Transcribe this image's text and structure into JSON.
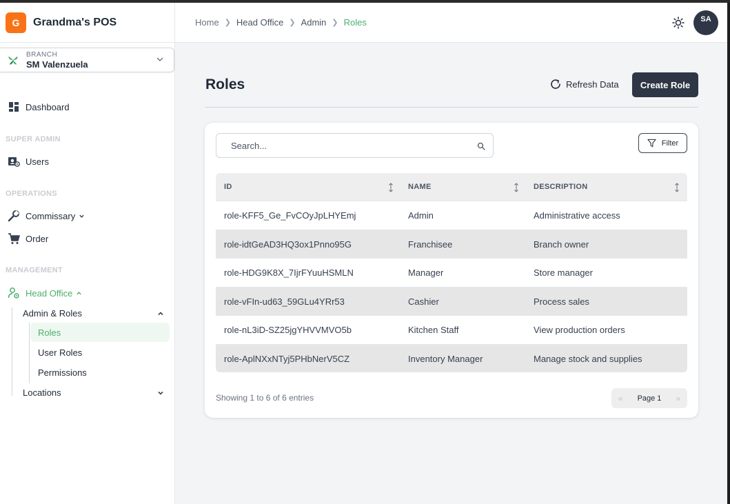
{
  "brand": {
    "logo_letter": "G",
    "name": "Grandma's POS",
    "accent": "#f97316"
  },
  "branch": {
    "label": "BRANCH",
    "value": "SM Valenzuela"
  },
  "nav": {
    "dashboard": "Dashboard",
    "section_super_admin": "SUPER ADMIN",
    "users": "Users",
    "section_operations": "OPERATIONS",
    "commissary": "Commissary",
    "order": "Order",
    "section_management": "MANAGEMENT",
    "head_office": "Head Office",
    "admin_roles": "Admin & Roles",
    "roles": "Roles",
    "user_roles": "User Roles",
    "permissions": "Permissions",
    "locations": "Locations"
  },
  "breadcrumb": [
    "Home",
    "Head Office",
    "Admin",
    "Roles"
  ],
  "header": {
    "avatar_initials": "SA"
  },
  "page": {
    "title": "Roles",
    "refresh_label": "Refresh Data",
    "create_label": "Create Role"
  },
  "search": {
    "placeholder": "Search...",
    "value": ""
  },
  "filter_label": "Filter",
  "table": {
    "columns": [
      "ID",
      "NAME",
      "DESCRIPTION"
    ],
    "rows": [
      {
        "id": "role-KFF5_Ge_FvCOyJpLHYEmj",
        "name": "Admin",
        "description": "Administrative access"
      },
      {
        "id": "role-idtGeAD3HQ3ox1Pnno95G",
        "name": "Franchisee",
        "description": "Branch owner"
      },
      {
        "id": "role-HDG9K8X_7IjrFYuuHSMLN",
        "name": "Manager",
        "description": "Store manager"
      },
      {
        "id": "role-vFIn-ud63_59GLu4YRr53",
        "name": "Cashier",
        "description": "Process sales"
      },
      {
        "id": "role-nL3iD-SZ25jgYHVVMVO5b",
        "name": "Kitchen Staff",
        "description": "View production orders"
      },
      {
        "id": "role-AplNXxNTyj5PHbNerV5CZ",
        "name": "Inventory Manager",
        "description": "Manage stock and supplies"
      }
    ]
  },
  "footer": {
    "showing": "Showing 1 to 6 of 6 entries",
    "page_label": "Page 1",
    "prev": "«",
    "next": "»"
  },
  "colors": {
    "green_active": "#4caf6e",
    "dark_button": "#2f3746"
  },
  "icons": {
    "dashboard": "dashboard-icon",
    "users": "users-icon",
    "commissary": "wrench-icon",
    "order": "cart-icon",
    "head_office": "user-gear-icon",
    "theme": "sun-icon",
    "branch": "leaf-icon"
  }
}
